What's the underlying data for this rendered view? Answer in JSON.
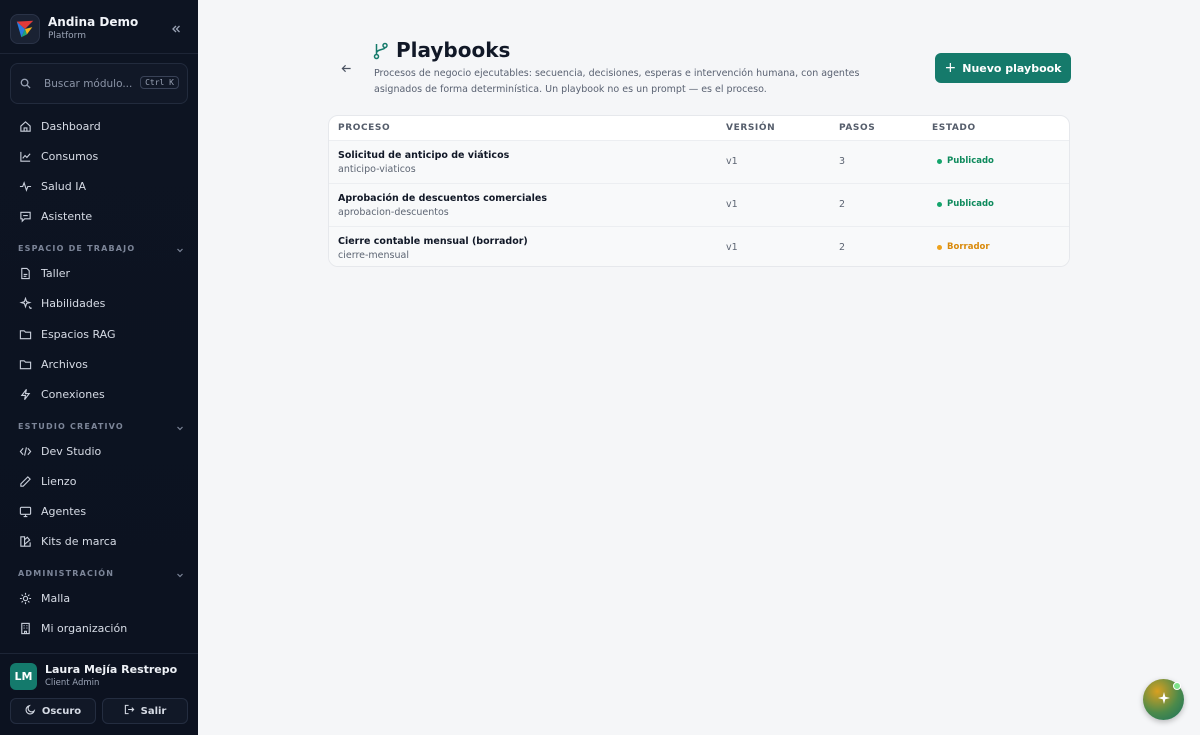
{
  "app": {
    "title": "Andina Demo",
    "subtitle": "Platform"
  },
  "search": {
    "placeholder": "Buscar módulo...",
    "shortcut": "Ctrl K"
  },
  "nav": {
    "main": [
      {
        "label": "Dashboard",
        "icon": "home-icon"
      },
      {
        "label": "Consumos",
        "icon": "chart-line-icon"
      },
      {
        "label": "Salud IA",
        "icon": "pulse-icon"
      },
      {
        "label": "Asistente",
        "icon": "chat-icon"
      }
    ],
    "sections": [
      {
        "label": "ESPACIO DE TRABAJO",
        "items": [
          {
            "label": "Taller",
            "icon": "document-icon"
          },
          {
            "label": "Habilidades",
            "icon": "sparkles-icon"
          },
          {
            "label": "Espacios RAG",
            "icon": "folder-icon"
          },
          {
            "label": "Archivos",
            "icon": "folder-icon"
          },
          {
            "label": "Conexiones",
            "icon": "bolt-icon"
          }
        ]
      },
      {
        "label": "ESTUDIO CREATIVO",
        "items": [
          {
            "label": "Dev Studio",
            "icon": "code-icon"
          },
          {
            "label": "Lienzo",
            "icon": "pencil-icon"
          },
          {
            "label": "Agentes",
            "icon": "monitor-icon"
          },
          {
            "label": "Kits de marca",
            "icon": "palette-icon"
          }
        ]
      },
      {
        "label": "ADMINISTRACIÓN",
        "items": [
          {
            "label": "Malla",
            "icon": "sun-icon"
          },
          {
            "label": "Mi organización",
            "icon": "building-icon"
          }
        ]
      }
    ]
  },
  "user": {
    "initials": "LM",
    "name": "Laura Mejía Restrepo",
    "role": "Client Admin"
  },
  "footer": {
    "theme_label": "Oscuro",
    "logout_label": "Salir"
  },
  "page": {
    "title": "Playbooks",
    "description": "Procesos de negocio ejecutables: secuencia, decisiones, esperas e intervención humana, con agentes asignados de forma determinística. Un playbook no es un prompt — es el proceso.",
    "new_button": "Nuevo playbook"
  },
  "table": {
    "headers": {
      "process": "PROCESO",
      "version": "VERSIÓN",
      "steps": "PASOS",
      "status": "ESTADO"
    },
    "rows": [
      {
        "name": "Solicitud de anticipo de viáticos",
        "slug": "anticipo-viaticos",
        "version": "v1",
        "steps": "3",
        "status": "Publicado"
      },
      {
        "name": "Aprobación de descuentos comerciales",
        "slug": "aprobacion-descuentos",
        "version": "v1",
        "steps": "2",
        "status": "Publicado"
      },
      {
        "name": "Cierre contable mensual (borrador)",
        "slug": "cierre-mensual",
        "version": "v1",
        "steps": "2",
        "status": "Borrador"
      }
    ]
  },
  "colors": {
    "accent": "#157a6b",
    "published": "#0e8a5c",
    "draft": "#d98a0b",
    "sidebar": "#0d1422"
  }
}
